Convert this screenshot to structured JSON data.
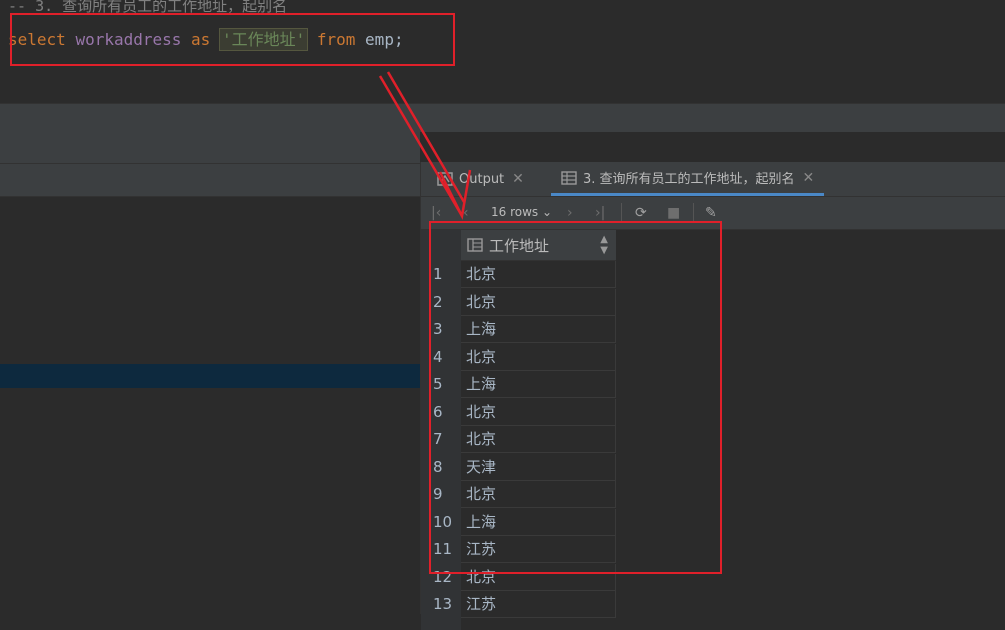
{
  "editor": {
    "comment": "-- 3. 查询所有员工的工作地址，起别名",
    "sql": {
      "kw_select": "select",
      "column": "workaddress",
      "kw_as": "as",
      "alias": "'工作地址'",
      "kw_from": "from",
      "table": "emp;"
    }
  },
  "results": {
    "tabs": [
      {
        "label": "Output",
        "icon": "output-icon"
      },
      {
        "label": "3. 查询所有员工的工作地址，起别名",
        "icon": "table-icon"
      }
    ],
    "toolbar": {
      "rows_label": "16 rows",
      "first_icon": "first-page-icon",
      "prev_icon": "prev-page-icon",
      "next_icon": "next-page-icon",
      "last_icon": "last-page-icon",
      "refresh_icon": "refresh-icon",
      "stop_icon": "stop-icon",
      "pin_icon": "pin-icon"
    },
    "column_header": "工作地址",
    "rows": [
      {
        "num": "1",
        "value": "北京"
      },
      {
        "num": "2",
        "value": "北京"
      },
      {
        "num": "3",
        "value": "上海"
      },
      {
        "num": "4",
        "value": "北京"
      },
      {
        "num": "5",
        "value": "上海"
      },
      {
        "num": "6",
        "value": "北京"
      },
      {
        "num": "7",
        "value": "北京"
      },
      {
        "num": "8",
        "value": "天津"
      },
      {
        "num": "9",
        "value": "北京"
      },
      {
        "num": "10",
        "value": "上海"
      },
      {
        "num": "11",
        "value": "江苏"
      },
      {
        "num": "12",
        "value": "北京"
      },
      {
        "num": "13",
        "value": "江苏"
      }
    ]
  },
  "colors": {
    "annotation": "#e0202a",
    "keyword": "#cc7832",
    "identifier": "#9876aa",
    "string": "#6a8759"
  }
}
